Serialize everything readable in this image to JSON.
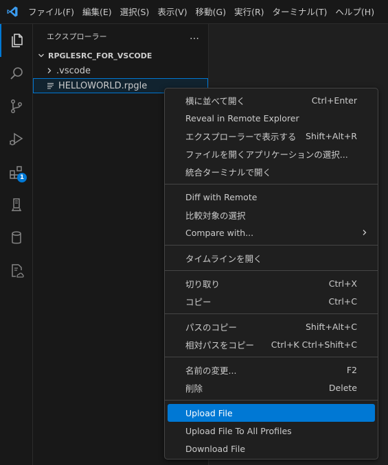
{
  "menubar": {
    "items": [
      "ファイル(F)",
      "編集(E)",
      "選択(S)",
      "表示(V)",
      "移動(G)",
      "実行(R)",
      "ターミナル(T)",
      "ヘルプ(H)"
    ]
  },
  "activity": {
    "extensions_badge": "1"
  },
  "sidebar": {
    "title": "エクスプローラー",
    "more": "…",
    "folder": "RPGLESRC_FOR_VSCODE",
    "items": [
      ".vscode",
      "HELLOWORLD.rpgle"
    ]
  },
  "context_menu": {
    "groups": [
      [
        {
          "label": "横に並べて開く",
          "key": "Ctrl+Enter"
        },
        {
          "label": "Reveal in Remote Explorer",
          "key": ""
        },
        {
          "label": "エクスプローラーで表示する",
          "key": "Shift+Alt+R"
        },
        {
          "label": "ファイルを開くアプリケーションの選択...",
          "key": ""
        },
        {
          "label": "統合ターミナルで開く",
          "key": ""
        }
      ],
      [
        {
          "label": "Diff with Remote",
          "key": ""
        },
        {
          "label": "比較対象の選択",
          "key": ""
        },
        {
          "label": "Compare with...",
          "key": ""
        }
      ],
      [
        {
          "label": "タイムラインを開く",
          "key": ""
        }
      ],
      [
        {
          "label": "切り取り",
          "key": "Ctrl+X"
        },
        {
          "label": "コピー",
          "key": "Ctrl+C"
        }
      ],
      [
        {
          "label": "パスのコピー",
          "key": "Shift+Alt+C"
        },
        {
          "label": "相対パスをコピー",
          "key": "Ctrl+K Ctrl+Shift+C"
        }
      ],
      [
        {
          "label": "名前の変更...",
          "key": "F2"
        },
        {
          "label": "削除",
          "key": "Delete"
        }
      ],
      [
        {
          "label": "Upload File",
          "key": ""
        },
        {
          "label": "Upload File To All Profiles",
          "key": ""
        },
        {
          "label": "Download File",
          "key": ""
        }
      ]
    ]
  },
  "colors": {
    "accent": "#0078d4",
    "bg": "#1f1f1f",
    "bar": "#181818"
  }
}
